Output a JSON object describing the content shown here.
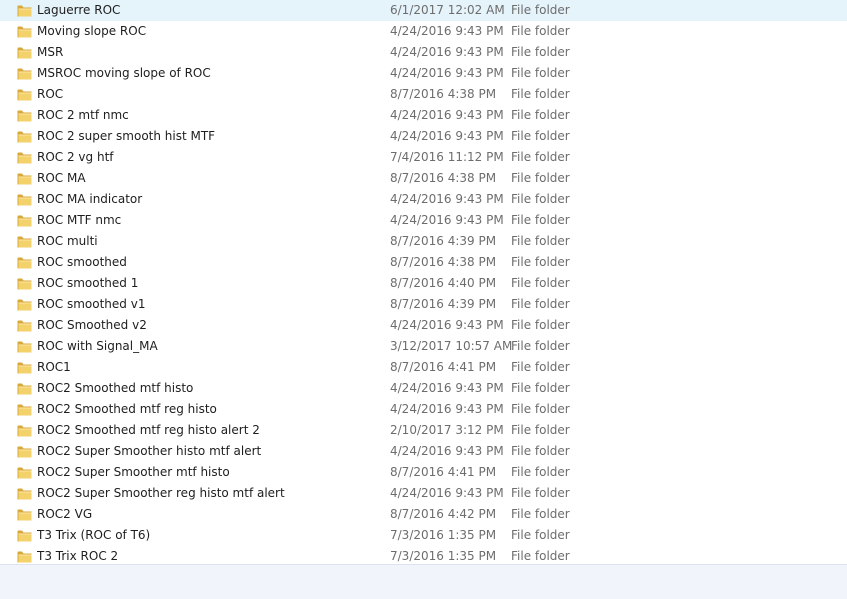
{
  "icons": {
    "folder": "folder-icon"
  },
  "colors": {
    "folder_fill": "#f3d16b",
    "folder_dark": "#d8a93a",
    "status_bar": "#f1f5fb"
  },
  "files": [
    {
      "name": "Laguerre ROC",
      "date": "6/1/2017 12:02 AM",
      "type": "File folder"
    },
    {
      "name": "Moving slope ROC",
      "date": "4/24/2016 9:43 PM",
      "type": "File folder"
    },
    {
      "name": "MSR",
      "date": "4/24/2016 9:43 PM",
      "type": "File folder"
    },
    {
      "name": "MSROC moving slope of ROC",
      "date": "4/24/2016 9:43 PM",
      "type": "File folder"
    },
    {
      "name": "ROC",
      "date": "8/7/2016 4:38 PM",
      "type": "File folder"
    },
    {
      "name": "ROC 2  mtf nmc",
      "date": "4/24/2016 9:43 PM",
      "type": "File folder"
    },
    {
      "name": "ROC 2 super smooth hist MTF",
      "date": "4/24/2016 9:43 PM",
      "type": "File folder"
    },
    {
      "name": "ROC 2 vg htf",
      "date": "7/4/2016 11:12 PM",
      "type": "File folder"
    },
    {
      "name": "ROC MA",
      "date": "8/7/2016 4:38 PM",
      "type": "File folder"
    },
    {
      "name": "ROC MA indicator",
      "date": "4/24/2016 9:43 PM",
      "type": "File folder"
    },
    {
      "name": "ROC MTF nmc",
      "date": "4/24/2016 9:43 PM",
      "type": "File folder"
    },
    {
      "name": "ROC multi",
      "date": "8/7/2016 4:39 PM",
      "type": "File folder"
    },
    {
      "name": "ROC smoothed",
      "date": "8/7/2016 4:38 PM",
      "type": "File folder"
    },
    {
      "name": "ROC smoothed 1",
      "date": "8/7/2016 4:40 PM",
      "type": "File folder"
    },
    {
      "name": "ROC smoothed v1",
      "date": "8/7/2016 4:39 PM",
      "type": "File folder"
    },
    {
      "name": "ROC Smoothed v2",
      "date": "4/24/2016 9:43 PM",
      "type": "File folder"
    },
    {
      "name": "ROC with Signal_MA",
      "date": "3/12/2017 10:57 AM",
      "type": "File folder"
    },
    {
      "name": "ROC1",
      "date": "8/7/2016 4:41 PM",
      "type": "File folder"
    },
    {
      "name": "ROC2 Smoothed mtf histo",
      "date": "4/24/2016 9:43 PM",
      "type": "File folder"
    },
    {
      "name": "ROC2 Smoothed mtf reg histo",
      "date": "4/24/2016 9:43 PM",
      "type": "File folder"
    },
    {
      "name": "ROC2 Smoothed mtf reg histo alert 2",
      "date": "2/10/2017 3:12 PM",
      "type": "File folder"
    },
    {
      "name": "ROC2 Super Smoother histo mtf alert",
      "date": "4/24/2016 9:43 PM",
      "type": "File folder"
    },
    {
      "name": "ROC2 Super Smoother mtf histo",
      "date": "8/7/2016 4:41 PM",
      "type": "File folder"
    },
    {
      "name": "ROC2 Super Smoother reg histo mtf alert",
      "date": "4/24/2016 9:43 PM",
      "type": "File folder"
    },
    {
      "name": "ROC2 VG",
      "date": "8/7/2016 4:42 PM",
      "type": "File folder"
    },
    {
      "name": "T3 Trix (ROC of T6)",
      "date": "7/3/2016 1:35 PM",
      "type": "File folder"
    },
    {
      "name": "T3 Trix ROC 2",
      "date": "7/3/2016 1:35 PM",
      "type": "File folder"
    }
  ],
  "status": {
    "text": ""
  }
}
